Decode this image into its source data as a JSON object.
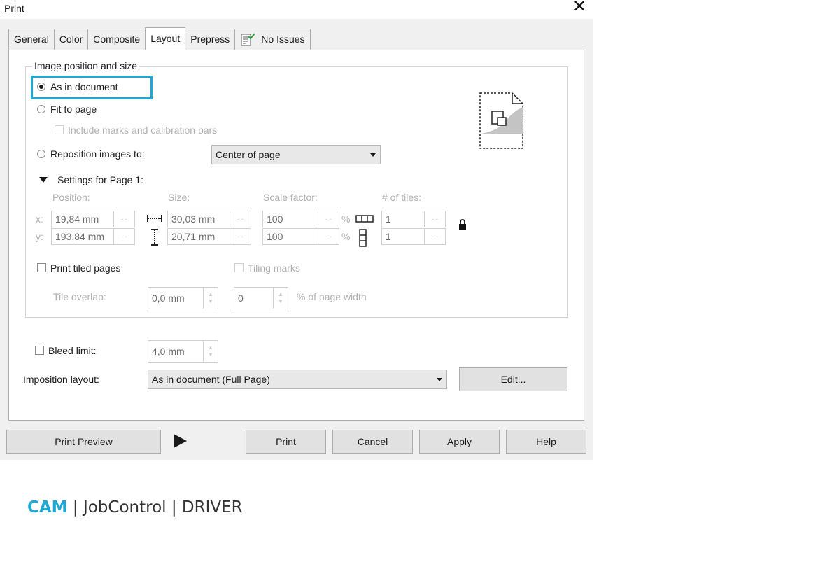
{
  "window": {
    "title": "Print"
  },
  "tabs": [
    {
      "label": "General"
    },
    {
      "label": "Color"
    },
    {
      "label": "Composite"
    },
    {
      "label": "Layout",
      "active": true
    },
    {
      "label": "Prepress"
    },
    {
      "label": "No Issues"
    }
  ],
  "group": {
    "legend": "Image position and size",
    "as_in_document": "As in document",
    "fit_to_page": "Fit to page",
    "include_marks": "Include marks and calibration bars",
    "reposition": "Reposition images to:",
    "reposition_value": "Center of page",
    "settings": "Settings for Page 1:",
    "headers": {
      "position": "Position:",
      "size": "Size:",
      "scale": "Scale factor:",
      "tiles": "# of tiles:"
    },
    "x_label": "x:",
    "y_label": "y:",
    "x_pos": "19,84 mm",
    "y_pos": "193,84 mm",
    "width": "30,03 mm",
    "height": "20,71 mm",
    "scale_x": "100",
    "scale_y": "100",
    "percent": "%",
    "tiles_x": "1",
    "tiles_y": "1",
    "print_tiled": "Print tiled pages",
    "tiling_marks": "Tiling marks",
    "tile_overlap": "Tile overlap:",
    "tile_overlap_value": "0,0 mm",
    "tile_percent_value": "0",
    "page_width": "% of page width"
  },
  "bleed": {
    "label": "Bleed limit:",
    "value": "4,0 mm"
  },
  "imposition": {
    "label": "Imposition layout:",
    "value": "As in document (Full Page)",
    "edit": "Edit..."
  },
  "buttons": {
    "preview": "Print Preview",
    "print": "Print",
    "cancel": "Cancel",
    "apply": "Apply",
    "help": "Help"
  },
  "brand": {
    "cam": "CAM",
    "rest": " | JobControl | DRIVER"
  },
  "colors": {
    "accent": "#1fa8d4"
  }
}
